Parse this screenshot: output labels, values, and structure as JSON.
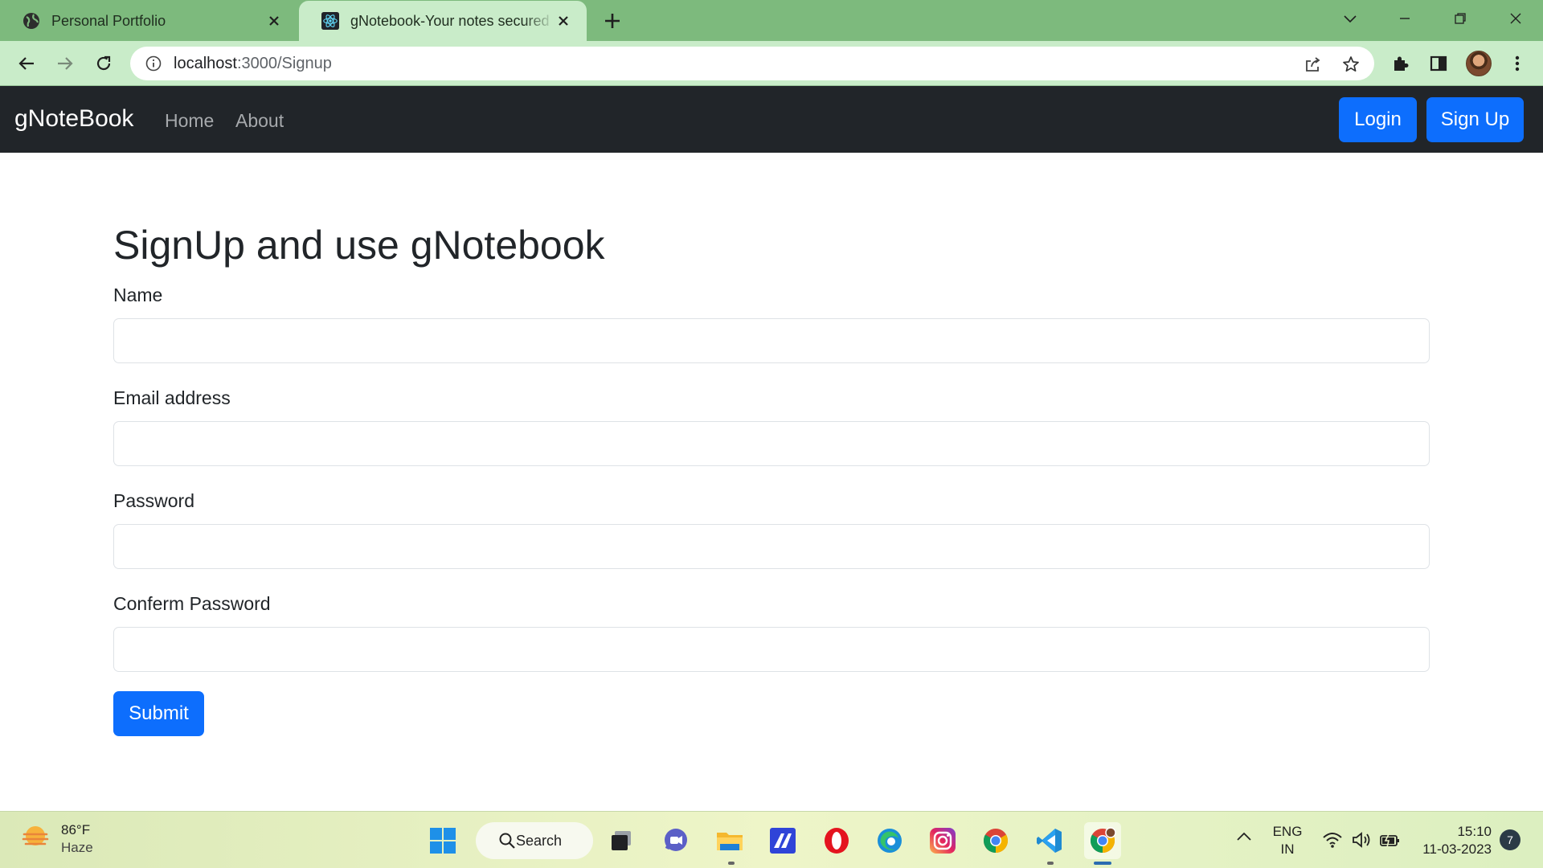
{
  "browser": {
    "tabs": [
      {
        "title": "Personal Portfolio",
        "active": false
      },
      {
        "title": "gNotebook-Your notes secured in the cloud",
        "active": true
      }
    ],
    "address_bar": {
      "host": "localhost",
      "path": ":3000/Signup"
    }
  },
  "navbar": {
    "brand": "gNoteBook",
    "links": [
      "Home",
      "About"
    ],
    "login_label": "Login",
    "signup_label": "Sign Up"
  },
  "form": {
    "title": "SignUp and use gNotebook",
    "fields": [
      {
        "label": "Name",
        "value": ""
      },
      {
        "label": "Email address",
        "value": ""
      },
      {
        "label": "Password",
        "value": ""
      },
      {
        "label": "Conferm Password",
        "value": ""
      }
    ],
    "submit_label": "Submit"
  },
  "taskbar": {
    "weather": {
      "temp": "86°F",
      "condition": "Haze"
    },
    "search_label": "Search",
    "apps": [
      "start-icon",
      "search",
      "task-view-icon",
      "teams-chat-icon",
      "file-explorer-icon",
      "text-editor-icon",
      "opera-icon",
      "edge-icon",
      "instagram-icon",
      "chrome-icon",
      "vscode-icon",
      "chrome-profile-icon"
    ],
    "tray": {
      "language": "ENG",
      "region": "IN",
      "time": "15:10",
      "date": "11-03-2023",
      "notifications": "7"
    }
  },
  "colors": {
    "tabstrip": "#7dba7d",
    "toolbar": "#c9ecc9",
    "navbar": "#212529",
    "primary": "#0d6efd"
  }
}
